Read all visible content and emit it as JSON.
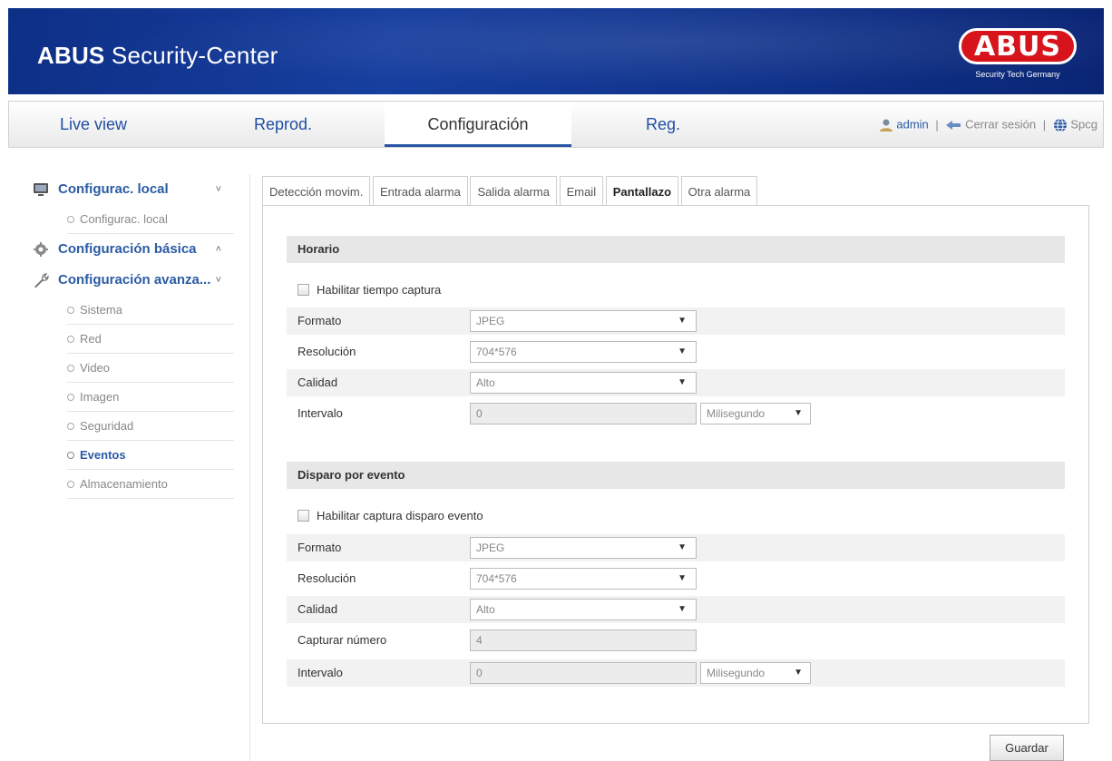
{
  "header": {
    "app_title_bold": "ABUS",
    "app_title_rest": " Security-Center",
    "logo_word": "ABUS",
    "logo_tagline": "Security Tech Germany",
    "brand_red": "#d7141b",
    "brand_blue": "#173f9f"
  },
  "nav": {
    "tabs": [
      {
        "label": "Live view"
      },
      {
        "label": "Reprod."
      },
      {
        "label": "Configuración"
      },
      {
        "label": "Reg."
      }
    ],
    "active_tab": "Configuración",
    "user": "admin",
    "logout": "Cerrar sesión",
    "language": "Spcg",
    "separator": "|"
  },
  "sidebar": {
    "groups": [
      {
        "label": "Configurac. local",
        "chevron": "˅",
        "items": [
          {
            "label": "Configurac. local"
          }
        ]
      },
      {
        "label": "Configuración básica",
        "chevron": "˄"
      },
      {
        "label": "Configuración avanza...",
        "chevron": "˅",
        "items": [
          {
            "label": "Sistema"
          },
          {
            "label": "Red"
          },
          {
            "label": "Video"
          },
          {
            "label": "Imagen"
          },
          {
            "label": "Seguridad"
          },
          {
            "label": "Eventos"
          },
          {
            "label": "Almacenamiento"
          }
        ]
      }
    ],
    "active_item": "Eventos"
  },
  "subtabs": [
    {
      "label": "Detección movim."
    },
    {
      "label": "Entrada alarma"
    },
    {
      "label": "Salida alarma"
    },
    {
      "label": "Email"
    },
    {
      "label": "Pantallazo"
    },
    {
      "label": "Otra alarma"
    }
  ],
  "active_subtab": "Pantallazo",
  "horario": {
    "title": "Horario",
    "enable_label": "Habilitar tiempo captura",
    "enable_checked": false,
    "formato_label": "Formato",
    "formato_value": "JPEG",
    "resolucion_label": "Resolución",
    "resolucion_value": "704*576",
    "calidad_label": "Calidad",
    "calidad_value": "Alto",
    "intervalo_label": "Intervalo",
    "intervalo_value": "0",
    "intervalo_unit": "Milisegundo"
  },
  "evento": {
    "title": "Disparo por evento",
    "enable_label": "Habilitar captura disparo evento",
    "enable_checked": false,
    "formato_label": "Formato",
    "formato_value": "JPEG",
    "resolucion_label": "Resolución",
    "resolucion_value": "704*576",
    "calidad_label": "Calidad",
    "calidad_value": "Alto",
    "capturar_label": "Capturar número",
    "capturar_value": "4",
    "intervalo_label": "Intervalo",
    "intervalo_value": "0",
    "intervalo_unit": "Milisegundo"
  },
  "actions": {
    "save_label": "Guardar"
  },
  "icons": {
    "dropdown_arrow": "▼",
    "user": "user-icon",
    "logout": "logout-icon",
    "language": "globe-icon",
    "local": "monitor-icon",
    "basic": "gear-icon",
    "advanced": "wrench-icon"
  }
}
